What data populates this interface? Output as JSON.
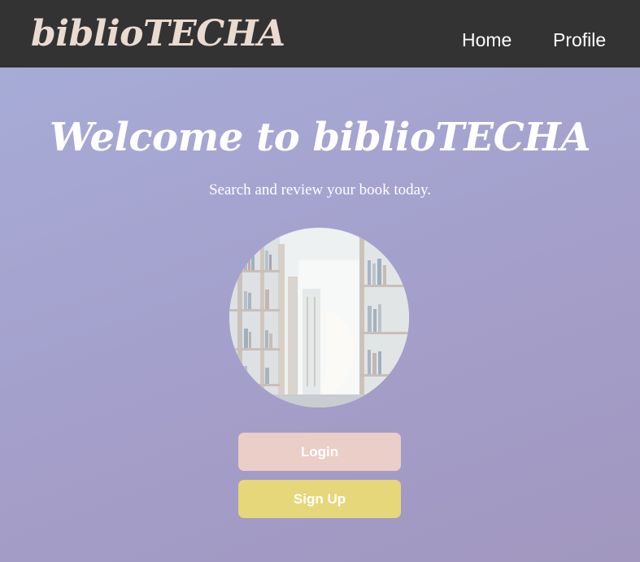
{
  "navbar": {
    "brand": "biblioTECHA",
    "links": [
      {
        "label": "Home"
      },
      {
        "label": "Profile"
      }
    ]
  },
  "hero": {
    "title": "Welcome to biblioTECHA",
    "subtitle": "Search and review your book today."
  },
  "image": {
    "semantic": "library-bookshelves-illustration"
  },
  "actions": {
    "login_label": "Login",
    "signup_label": "Sign Up"
  },
  "colors": {
    "navbar_bg": "#333333",
    "brand_text": "#eadbd0",
    "login_button": "#eacec7",
    "signup_button": "#e5d77a",
    "background_gradient": [
      "#a7aed9",
      "#a197bf"
    ]
  }
}
